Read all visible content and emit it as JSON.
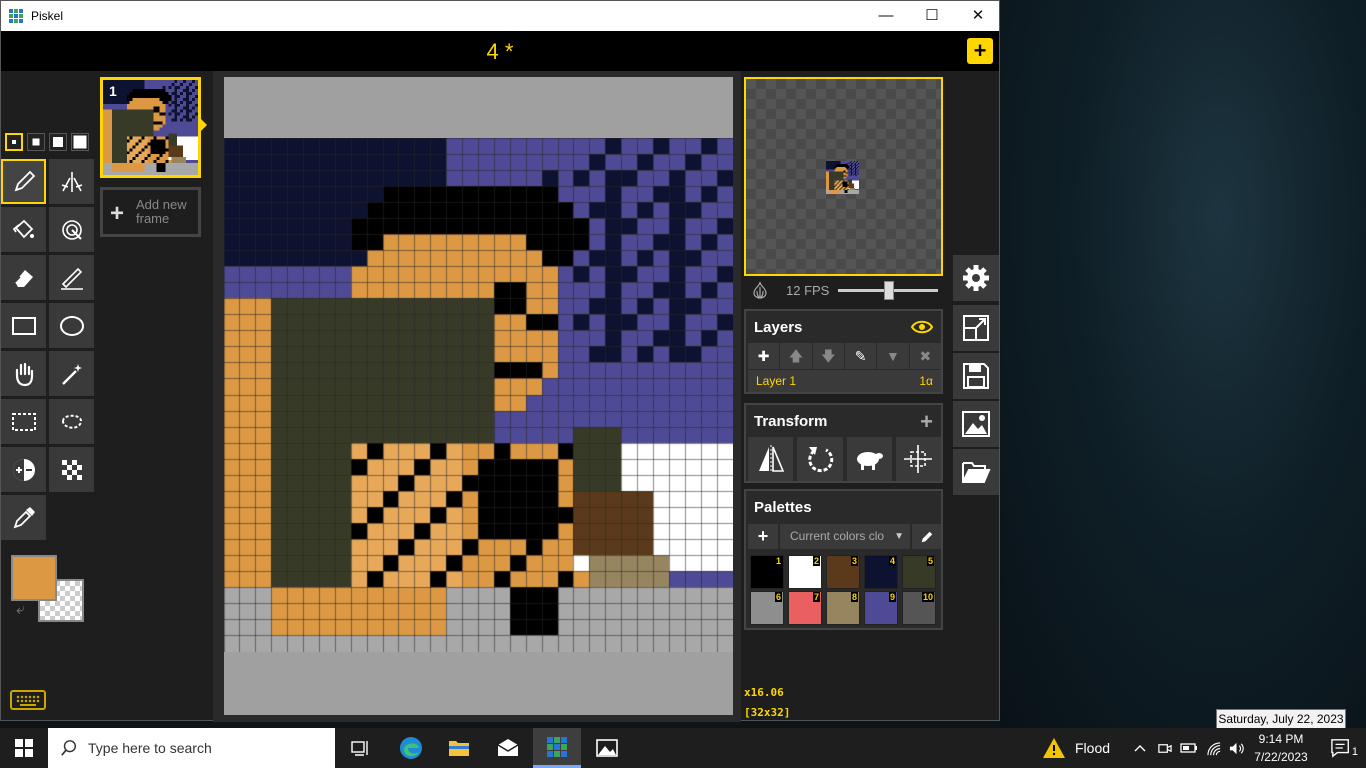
{
  "window": {
    "app_title": "Piskel",
    "doc_title": "4 *",
    "new_button": "+"
  },
  "frames": [
    {
      "number": "1"
    }
  ],
  "add_frame_label": "Add new frame",
  "fps": {
    "label": "12 FPS",
    "value": 12
  },
  "layers": {
    "title": "Layers",
    "items": [
      {
        "name": "Layer 1",
        "alpha": "1α"
      }
    ]
  },
  "transform": {
    "title": "Transform"
  },
  "palettes": {
    "title": "Palettes",
    "selected": "Current colors clo",
    "swatches": [
      {
        "n": "1",
        "color": "#000000"
      },
      {
        "n": "2",
        "color": "#ffffff"
      },
      {
        "n": "3",
        "color": "#5a3a1a"
      },
      {
        "n": "4",
        "color": "#0d1230"
      },
      {
        "n": "5",
        "color": "#383a28"
      },
      {
        "n": "6",
        "color": "#8e8e8e"
      },
      {
        "n": "7",
        "color": "#ea6060"
      },
      {
        "n": "8",
        "color": "#978560"
      },
      {
        "n": "9",
        "color": "#4e4a96"
      },
      {
        "n": "10",
        "color": "#555555"
      }
    ]
  },
  "zoom": {
    "level": "x16.06",
    "size": "[32x32]"
  },
  "colors": {
    "primary": "#dd9844",
    "accent": "#ffd700"
  },
  "taskbar": {
    "search_placeholder": "Type here to search",
    "weather": "Flood",
    "time": "9:14 PM",
    "date": "7/22/2023",
    "tooltip": "Saturday, July 22, 2023",
    "notifications": "1"
  }
}
